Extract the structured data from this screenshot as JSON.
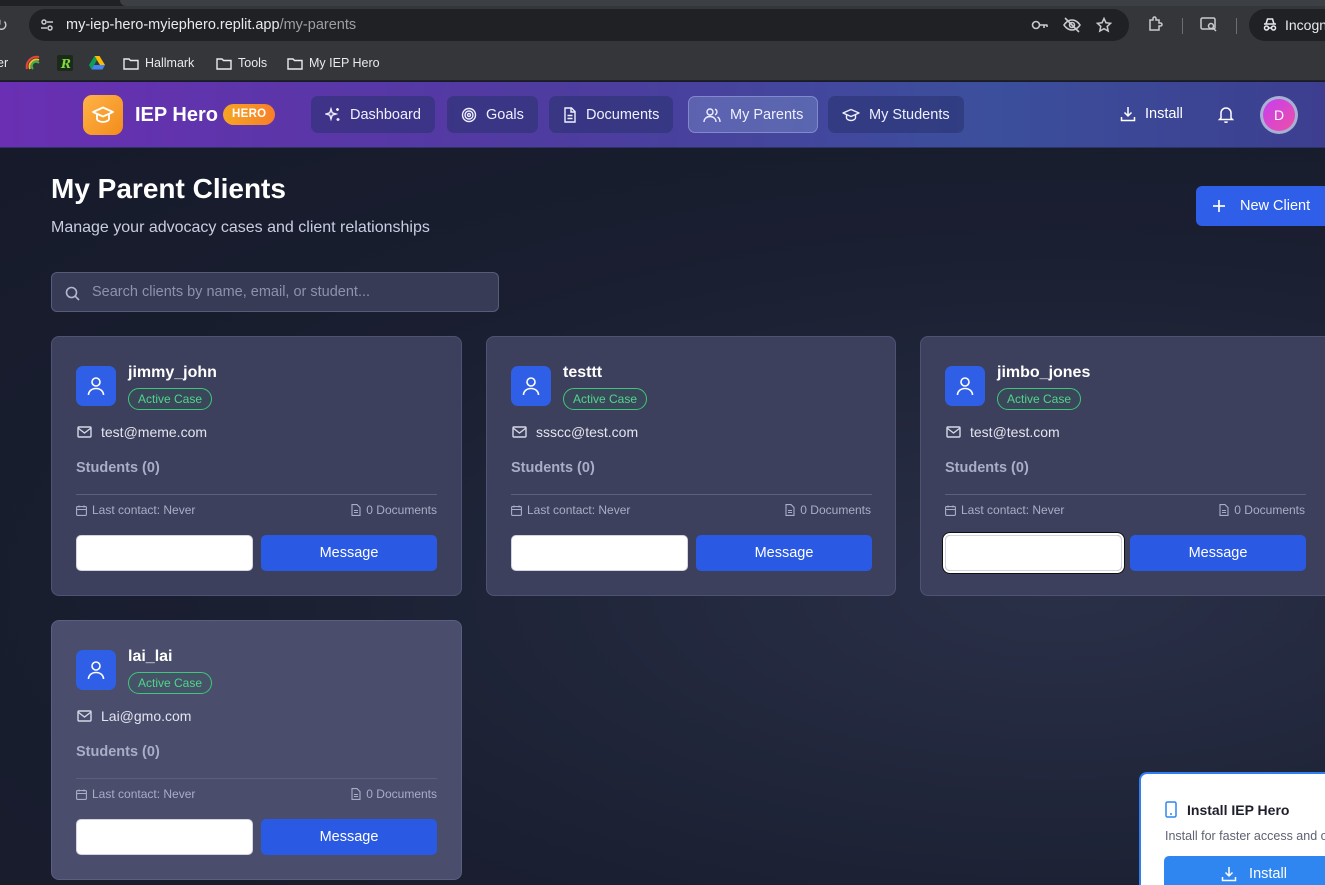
{
  "browser": {
    "url_host": "my-iep-hero-myiephero.replit.app",
    "url_path": "/my-parents",
    "profile_label": "Incogn",
    "bookmarks": [
      {
        "label": "er"
      },
      {
        "label": "Hallmark"
      },
      {
        "label": "Tools"
      },
      {
        "label": "My IEP Hero"
      }
    ]
  },
  "header": {
    "brand": "IEP Hero",
    "badge": "HERO",
    "nav": [
      {
        "label": "Dashboard",
        "icon": "sparkles-icon"
      },
      {
        "label": "Goals",
        "icon": "target-icon"
      },
      {
        "label": "Documents",
        "icon": "document-icon"
      },
      {
        "label": "My Parents",
        "icon": "users-icon",
        "active": true
      },
      {
        "label": "My Students",
        "icon": "graduation-cap-icon"
      }
    ],
    "install_label": "Install",
    "avatar_initial": "D"
  },
  "page": {
    "title": "My Parent Clients",
    "subtitle": "Manage your advocacy cases and client relationships",
    "new_client_label": "New Client",
    "search_placeholder": "Search clients by name, email, or student..."
  },
  "clients": [
    {
      "name": "jimmy_john",
      "status": "Active Case",
      "email": "test@meme.com",
      "students": "Students (0)",
      "last_contact": "Last contact: Never",
      "documents": "0 Documents",
      "message_label": "Message"
    },
    {
      "name": "testtt",
      "status": "Active Case",
      "email": "ssscc@test.com",
      "students": "Students (0)",
      "last_contact": "Last contact: Never",
      "documents": "0 Documents",
      "message_label": "Message"
    },
    {
      "name": "jimbo_jones",
      "status": "Active Case",
      "email": "test@test.com",
      "students": "Students (0)",
      "last_contact": "Last contact: Never",
      "documents": "0 Documents",
      "message_label": "Message"
    },
    {
      "name": "lai_lai",
      "status": "Active Case",
      "email": "Lai@gmo.com",
      "students": "Students (0)",
      "last_contact": "Last contact: Never",
      "documents": "0 Documents",
      "message_label": "Message"
    }
  ],
  "install_popup": {
    "title": "Install IEP Hero",
    "description": "Install for faster access and o",
    "button_label": "Install"
  },
  "colors": {
    "accent_blue": "#2a59e3",
    "active_green": "#4fd68b",
    "brand_orange": "#f5a623",
    "header_purple": "#6a2fb3"
  }
}
